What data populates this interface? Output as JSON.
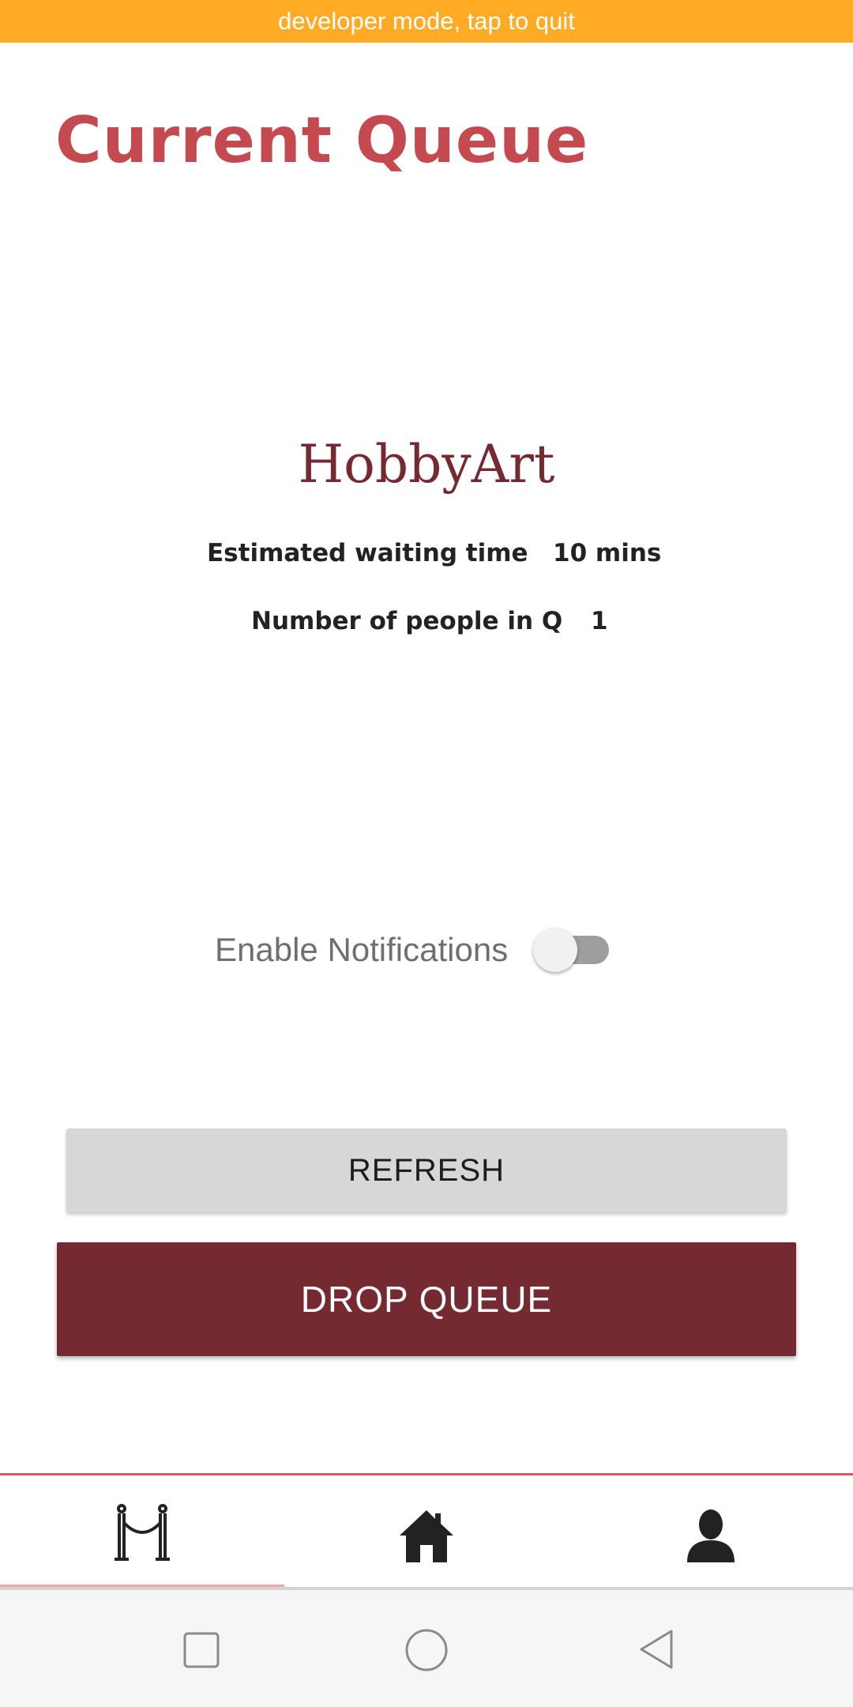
{
  "banner": {
    "text": "developer mode, tap to quit",
    "color": "#FFAB26"
  },
  "header": {
    "title": "Current Queue",
    "color": "#C44A4F"
  },
  "venue": {
    "name": "HobbyArt",
    "color": "#742A30"
  },
  "queue_info": {
    "wait_label": "Estimated waiting time",
    "wait_value": "10 mins",
    "people_label": "Number of people in Q",
    "people_value": "1"
  },
  "notifications": {
    "label": "Enable Notifications",
    "enabled": false
  },
  "buttons": {
    "refresh_label": "REFRESH",
    "drop_label": "DROP QUEUE",
    "drop_color": "#742A30"
  },
  "bottom_nav": {
    "items": [
      {
        "icon": "queue-stanchion-icon",
        "active": true
      },
      {
        "icon": "home-icon",
        "active": false
      },
      {
        "icon": "profile-icon",
        "active": false
      }
    ],
    "accent": "#E8545A"
  },
  "system_nav": {
    "items": [
      {
        "icon": "recents-square-icon"
      },
      {
        "icon": "home-circle-icon"
      },
      {
        "icon": "back-triangle-icon"
      }
    ]
  }
}
